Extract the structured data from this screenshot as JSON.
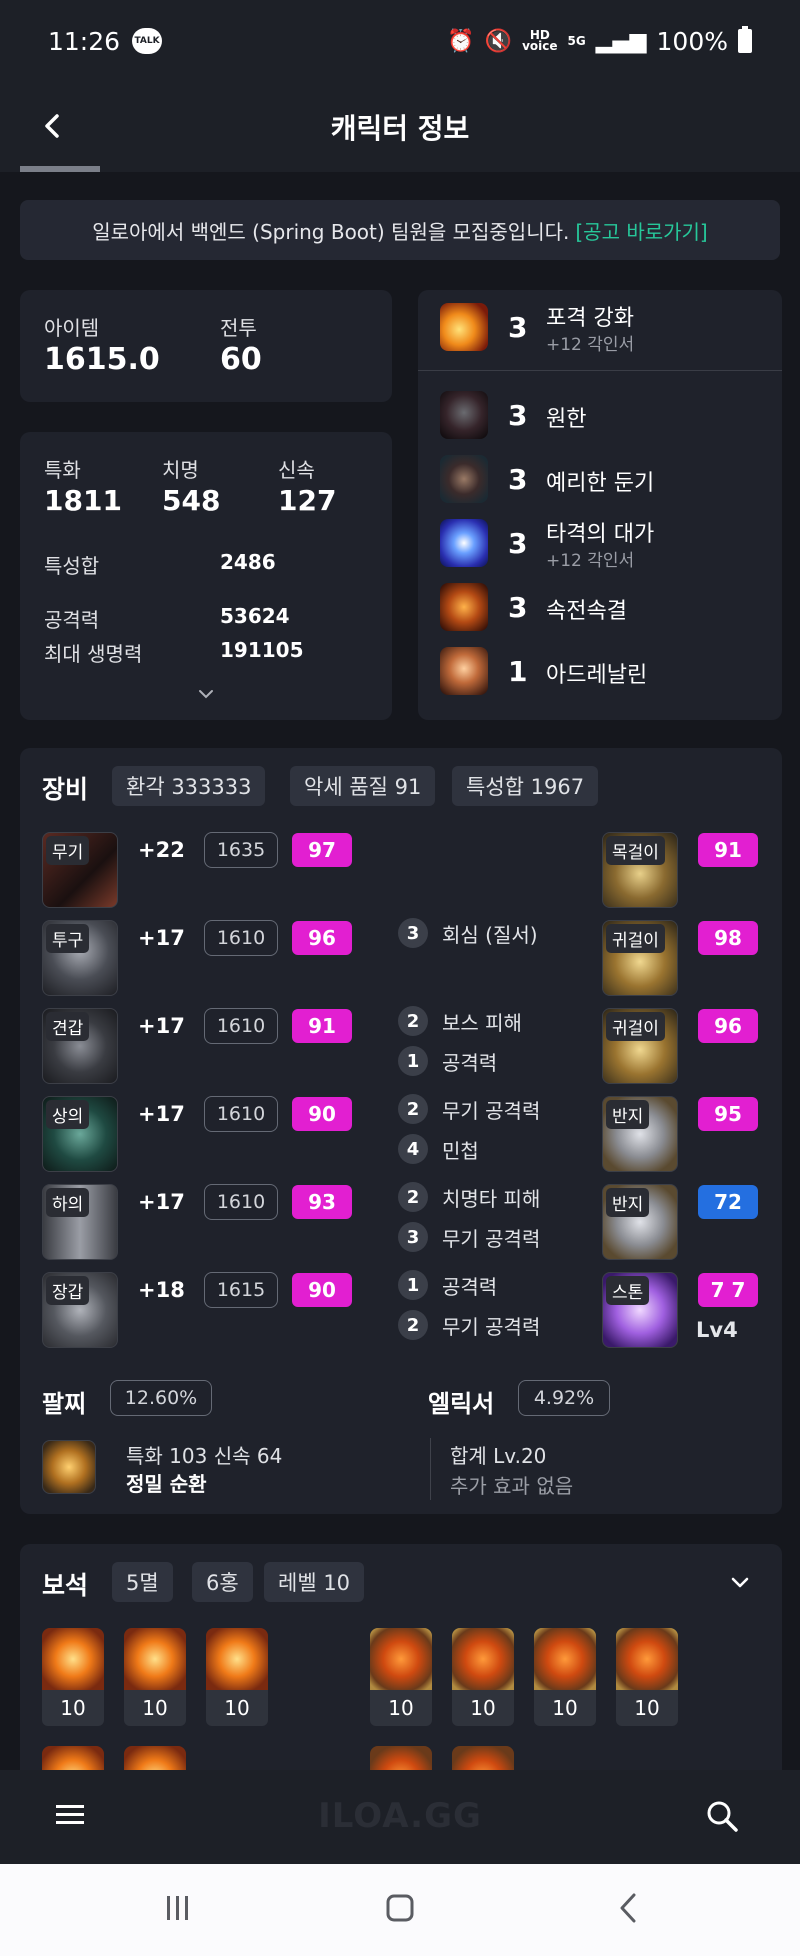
{
  "status": {
    "time": "11:26",
    "battery": "100%",
    "talk": "TALK",
    "hd_line1": "HD",
    "hd_line2": "voice",
    "net": "5G"
  },
  "header": {
    "title": "캐릭터 정보"
  },
  "notice": {
    "text": "일로아에서 백엔드 (Spring Boot) 팀원을 모집중입니다.",
    "link": "[공고 바로가기]"
  },
  "summary": {
    "item_label": "아이템",
    "item_value": "1615.0",
    "battle_label": "전투",
    "battle_value": "60"
  },
  "stats": {
    "spec_label": "특화",
    "spec_value": "1811",
    "crit_label": "치명",
    "crit_value": "548",
    "swift_label": "신속",
    "swift_value": "127",
    "total_label": "특성합",
    "total_value": "2486",
    "atk_label": "공격력",
    "atk_value": "53624",
    "hp_label": "최대 생명력",
    "hp_value": "191105"
  },
  "engravings": [
    {
      "level": "3",
      "name": "포격 강화",
      "sub": "+12 각인서",
      "icon": "explosion-icon"
    },
    {
      "level": "3",
      "name": "원한",
      "sub": "",
      "icon": "demon-icon"
    },
    {
      "level": "3",
      "name": "예리한 둔기",
      "sub": "",
      "icon": "blunt-spike-icon"
    },
    {
      "level": "3",
      "name": "타격의 대가",
      "sub": "+12 각인서",
      "icon": "lightning-icon"
    },
    {
      "level": "3",
      "name": "속전속결",
      "sub": "",
      "icon": "rush-icon"
    },
    {
      "level": "1",
      "name": "아드레날린",
      "sub": "",
      "icon": "adrenaline-icon"
    }
  ],
  "equipment": {
    "title": "장비",
    "chips": [
      "환각 333333",
      "악세 품질 91",
      "특성합 1967"
    ],
    "gear": [
      {
        "tag": "무기",
        "refine": "+22",
        "ilvl": "1635",
        "quality": "97"
      },
      {
        "tag": "투구",
        "refine": "+17",
        "ilvl": "1610",
        "quality": "96"
      },
      {
        "tag": "견갑",
        "refine": "+17",
        "ilvl": "1610",
        "quality": "91"
      },
      {
        "tag": "상의",
        "refine": "+17",
        "ilvl": "1610",
        "quality": "90"
      },
      {
        "tag": "하의",
        "refine": "+17",
        "ilvl": "1610",
        "quality": "93"
      },
      {
        "tag": "장갑",
        "refine": "+18",
        "ilvl": "1615",
        "quality": "90"
      }
    ],
    "effects": [
      {
        "n": "3",
        "text": "회심 (질서)"
      },
      {
        "n": "2",
        "text": "보스 피해"
      },
      {
        "n": "1",
        "text": "공격력"
      },
      {
        "n": "2",
        "text": "무기 공격력"
      },
      {
        "n": "4",
        "text": "민첩"
      },
      {
        "n": "2",
        "text": "치명타 피해"
      },
      {
        "n": "3",
        "text": "무기 공격력"
      },
      {
        "n": "1",
        "text": "공격력"
      },
      {
        "n": "2",
        "text": "무기 공격력"
      }
    ],
    "accessories": [
      {
        "tag": "목걸이",
        "quality": "91",
        "color": "#e21fd1"
      },
      {
        "tag": "귀걸이",
        "quality": "98",
        "color": "#e21fd1"
      },
      {
        "tag": "귀걸이",
        "quality": "96",
        "color": "#e21fd1"
      },
      {
        "tag": "반지",
        "quality": "95",
        "color": "#e21fd1"
      },
      {
        "tag": "반지",
        "quality": "72",
        "color": "#246fe0"
      },
      {
        "tag": "스톤",
        "quality": "7 7",
        "color": "#e21fd1"
      }
    ],
    "stone_level": "Lv4",
    "bracelet_label": "팔찌",
    "bracelet_pct": "12.60%",
    "bracelet_stats": "특화 103  신속 64",
    "bracelet_effects": "정밀  순환",
    "elixir_label": "엘릭서",
    "elixir_pct": "4.92%",
    "elixir_total": "합계 Lv.20",
    "elixir_extra": "추가 효과 없음"
  },
  "gems": {
    "title": "보석",
    "chips": [
      "5멸",
      "6홍",
      "레벨 10"
    ],
    "left_levels": [
      "10",
      "10",
      "10"
    ],
    "right_levels": [
      "10",
      "10",
      "10",
      "10"
    ]
  },
  "bottom": {
    "logo": "ILOA.GG"
  },
  "colors": {
    "accent_link": "#27c79a",
    "quality_pink": "#e21fd1",
    "quality_blue": "#246fe0"
  }
}
